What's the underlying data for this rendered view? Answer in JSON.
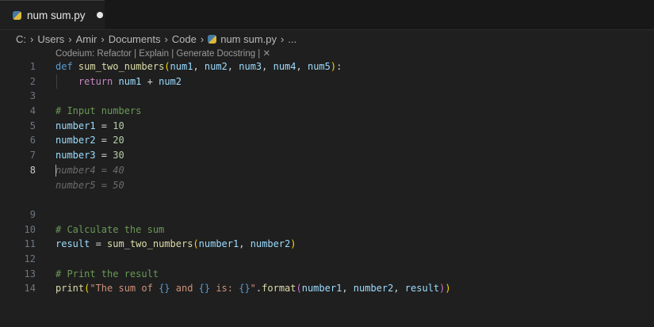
{
  "tab": {
    "label": "num sum.py",
    "icon": "python-file-icon",
    "modified": true
  },
  "breadcrumb": [
    "C:",
    "Users",
    "Amir",
    "Documents",
    "Code",
    "num sum.py",
    "..."
  ],
  "codelens": {
    "prefix": "Codeium: ",
    "actions": [
      "Refactor",
      "Explain",
      "Generate Docstring"
    ],
    "close": "✕"
  },
  "colors": {
    "keyword": "#569cd6",
    "function": "#dcdcaa",
    "variable": "#9cdcfe",
    "paren": "#ffd700",
    "paren2": "#da70d6",
    "control": "#c586c0",
    "comment": "#6a9955",
    "string": "#ce9178",
    "number": "#b5cea8",
    "text": "#d4d4d4"
  },
  "lines": [
    {
      "n": "1",
      "tokens": [
        [
          "def",
          "keyword"
        ],
        [
          " ",
          "text"
        ],
        [
          "sum_two_numbers",
          "function"
        ],
        [
          "(",
          "paren"
        ],
        [
          "num1",
          "variable"
        ],
        [
          ", ",
          "text"
        ],
        [
          "num2",
          "variable"
        ],
        [
          ", ",
          "text"
        ],
        [
          "num3",
          "variable"
        ],
        [
          ", ",
          "text"
        ],
        [
          "num4",
          "variable"
        ],
        [
          ", ",
          "text"
        ],
        [
          "num5",
          "variable"
        ],
        [
          ")",
          "paren"
        ],
        [
          ":",
          "text"
        ]
      ]
    },
    {
      "n": "2",
      "tokens": [
        [
          "    ",
          "text"
        ],
        [
          "return",
          "control"
        ],
        [
          " ",
          "text"
        ],
        [
          "num1",
          "variable"
        ],
        [
          " + ",
          "text"
        ],
        [
          "num2",
          "variable"
        ]
      ],
      "guide": true
    },
    {
      "n": "3",
      "tokens": []
    },
    {
      "n": "4",
      "tokens": [
        [
          "# Input numbers",
          "comment"
        ]
      ]
    },
    {
      "n": "5",
      "tokens": [
        [
          "number1",
          "variable"
        ],
        [
          " = ",
          "text"
        ],
        [
          "10",
          "number"
        ]
      ]
    },
    {
      "n": "6",
      "tokens": [
        [
          "number2",
          "variable"
        ],
        [
          " = ",
          "text"
        ],
        [
          "20",
          "number"
        ]
      ]
    },
    {
      "n": "7",
      "tokens": [
        [
          "number3",
          "variable"
        ],
        [
          " = ",
          "text"
        ],
        [
          "30",
          "number"
        ]
      ]
    },
    {
      "n": "8",
      "active": true,
      "cursor": true,
      "ghost": "number4 = 40"
    },
    {
      "n": "",
      "ghost": "number5 = 50"
    },
    {
      "n": "",
      "tokens": []
    },
    {
      "n": "9",
      "tokens": []
    },
    {
      "n": "10",
      "tokens": [
        [
          "# Calculate the sum",
          "comment"
        ]
      ]
    },
    {
      "n": "11",
      "tokens": [
        [
          "result",
          "variable"
        ],
        [
          " = ",
          "text"
        ],
        [
          "sum_two_numbers",
          "function"
        ],
        [
          "(",
          "paren"
        ],
        [
          "number1",
          "variable"
        ],
        [
          ", ",
          "text"
        ],
        [
          "number2",
          "variable"
        ],
        [
          ")",
          "paren"
        ]
      ]
    },
    {
      "n": "12",
      "tokens": []
    },
    {
      "n": "13",
      "tokens": [
        [
          "# Print the result",
          "comment"
        ]
      ]
    },
    {
      "n": "14",
      "tokens": [
        [
          "print",
          "function"
        ],
        [
          "(",
          "paren"
        ],
        [
          "\"The sum of ",
          "string"
        ],
        [
          "{}",
          "keyword"
        ],
        [
          " and ",
          "string"
        ],
        [
          "{}",
          "keyword"
        ],
        [
          " is: ",
          "string"
        ],
        [
          "{}",
          "keyword"
        ],
        [
          "\"",
          "string"
        ],
        [
          ".",
          "text"
        ],
        [
          "format",
          "function"
        ],
        [
          "(",
          "paren2"
        ],
        [
          "number1",
          "variable"
        ],
        [
          ", ",
          "text"
        ],
        [
          "number2",
          "variable"
        ],
        [
          ", ",
          "text"
        ],
        [
          "result",
          "variable"
        ],
        [
          ")",
          "paren2"
        ],
        [
          ")",
          "paren"
        ]
      ]
    }
  ]
}
